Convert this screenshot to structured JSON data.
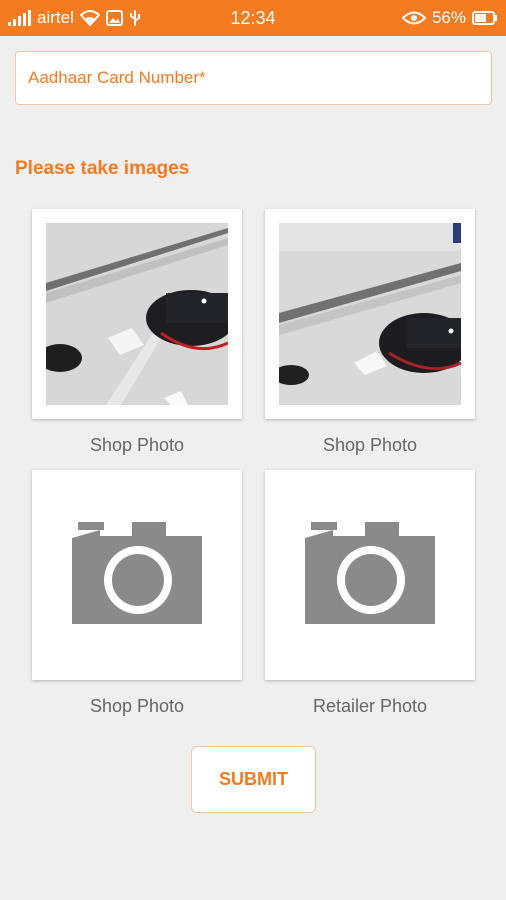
{
  "status_bar": {
    "carrier": "airtel",
    "time": "12:34",
    "battery": "56%"
  },
  "form": {
    "aadhaar_placeholder": "Aadhaar Card Number*",
    "section_title": "Please take images",
    "tiles": [
      {
        "label": "Shop Photo",
        "state": "captured"
      },
      {
        "label": "Shop Photo",
        "state": "captured"
      },
      {
        "label": "Shop Photo",
        "state": "empty"
      },
      {
        "label": "Retailer Photo",
        "state": "empty"
      }
    ],
    "submit_label": "SUBMIT"
  },
  "colors": {
    "accent": "#f47b20",
    "camera_icon": "#8a8a8a"
  }
}
